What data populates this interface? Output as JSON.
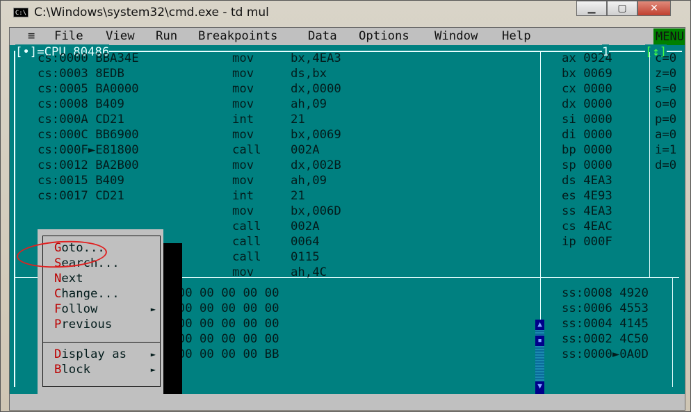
{
  "window": {
    "title": "C:\\Windows\\system32\\cmd.exe - td  mul",
    "icon": "cmd-icon",
    "controls": [
      "minimize",
      "maximize",
      "close"
    ]
  },
  "menubar": {
    "system": "≡",
    "items": [
      {
        "hot": "F",
        "rest": "ile"
      },
      {
        "hot": "V",
        "rest": "iew"
      },
      {
        "hot": "R",
        "rest": "un"
      },
      {
        "hot": "B",
        "rest": "reakpoints"
      },
      {
        "hot": "D",
        "rest": "ata"
      },
      {
        "hot": "O",
        "rest": "ptions"
      },
      {
        "hot": "W",
        "rest": "indow"
      },
      {
        "hot": "H",
        "rest": "elp"
      }
    ],
    "menu_flag": "MENU"
  },
  "cpu": {
    "title": "[•]=CPU 80486",
    "window_number": "1",
    "resize": "[↕]",
    "code": [
      {
        "addr": "cs:0000 BBA34E",
        "op": "mov",
        "arg": "bx,4EA3"
      },
      {
        "addr": "cs:0003 8EDB",
        "op": "mov",
        "arg": "ds,bx"
      },
      {
        "addr": "cs:0005 BA0000",
        "op": "mov",
        "arg": "dx,0000"
      },
      {
        "addr": "cs:0008 B409",
        "op": "mov",
        "arg": "ah,09"
      },
      {
        "addr": "cs:000A CD21",
        "op": "int",
        "arg": "21"
      },
      {
        "addr": "cs:000C BB6900",
        "op": "mov",
        "arg": "bx,0069"
      },
      {
        "addr": "cs:000F►E81800",
        "op": "call",
        "arg": "002A"
      },
      {
        "addr": "cs:0012 BA2B00",
        "op": "mov",
        "arg": "dx,002B"
      },
      {
        "addr": "cs:0015 B409",
        "op": "mov",
        "arg": "ah,09"
      },
      {
        "addr": "cs:0017 CD21",
        "op": "int",
        "arg": "21"
      },
      {
        "addr": "",
        "op": "mov",
        "arg": "bx,006D"
      },
      {
        "addr": "",
        "op": "call",
        "arg": "002A"
      },
      {
        "addr": "",
        "op": "call",
        "arg": "0064"
      },
      {
        "addr": "",
        "op": "call",
        "arg": "0115"
      },
      {
        "addr": "",
        "op": "mov",
        "arg": "ah,4C"
      }
    ],
    "registers": [
      "ax 0924",
      "bx 0069",
      "cx 0000",
      "dx 0000",
      "si 0000",
      "di 0000",
      "bp 0000",
      "sp 0000",
      "ds 4EA3",
      "es 4E93",
      "ss 4EA3",
      "cs 4EAC",
      "ip 000F"
    ],
    "flags": [
      "c=0",
      "z=0",
      "s=0",
      "o=0",
      "p=0",
      "a=0",
      "i=1",
      "d=0"
    ],
    "dump": [
      "0 00 00 00 00 00",
      "0 00 00 00 00 00",
      "0 00 00 00 00 00",
      "0 00 00 00 00 00",
      "0 00 00 00 00 BB"
    ],
    "stack": [
      "ss:0008 4920",
      "ss:0006 4553",
      "ss:0004 4145",
      "ss:0002 4C50",
      "ss:0000►0A0D"
    ]
  },
  "context_menu": {
    "items": [
      {
        "hot": "G",
        "rest": "oto...",
        "submenu": false
      },
      {
        "hot": "S",
        "rest": "earch...",
        "submenu": false
      },
      {
        "hot": "N",
        "rest": "ext",
        "submenu": false
      },
      {
        "hot": "C",
        "rest": "hange...",
        "submenu": false
      },
      {
        "hot": "F",
        "rest": "ollow",
        "submenu": true
      },
      {
        "hot": "P",
        "rest": "revious",
        "submenu": true
      },
      {
        "hot": "D",
        "rest": "isplay as",
        "submenu": true
      },
      {
        "hot": "B",
        "rest": "lock",
        "submenu": true
      }
    ],
    "highlight_annotation": "Goto..."
  }
}
